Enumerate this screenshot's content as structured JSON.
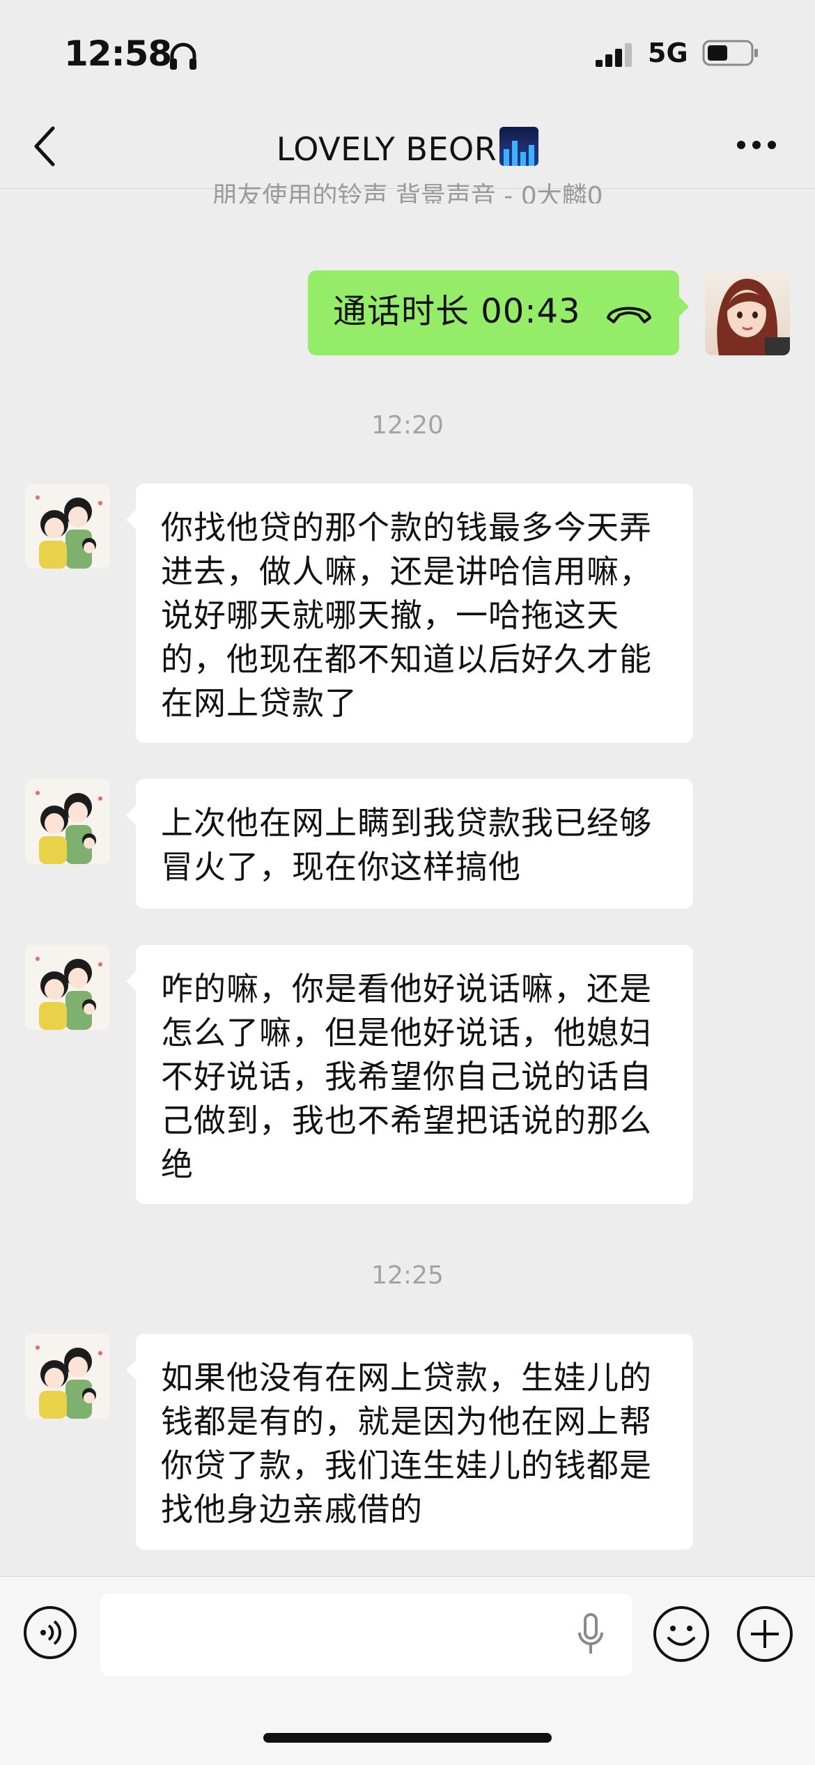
{
  "status_bar": {
    "time": "12:58",
    "network": "5G"
  },
  "nav": {
    "title": "LOVELY BEOR"
  },
  "partial_top_text": "朋友使用的铃声  背景声音 - 0大麟0",
  "call_message": {
    "text": "通话时长 00:43"
  },
  "timestamps": [
    "12:20",
    "12:25"
  ],
  "messages": [
    {
      "text": "你找他贷的那个款的钱最多今天弄进去，做人嘛，还是讲哈信用嘛，说好哪天就哪天撤，一哈拖这天的，他现在都不知道以后好久才能在网上贷款了"
    },
    {
      "text": "上次他在网上瞒到我贷款我已经够冒火了，现在你这样搞他"
    },
    {
      "text": "咋的嘛，你是看他好说话嘛，还是怎么了嘛，但是他好说话，他媳妇不好说话，我希望你自己说的话自己做到，我也不希望把话说的那么绝"
    },
    {
      "text": "如果他没有在网上贷款，生娃儿的钱都是有的，就是因为他在网上帮你贷了款，我们连生娃儿的钱都是找他身边亲戚借的"
    }
  ],
  "input": {
    "placeholder": ""
  },
  "colors": {
    "background": "#ededed",
    "sent_bubble": "#95ec69",
    "received_bubble": "#ffffff"
  },
  "icons": [
    "headphone-icon",
    "signal-icon",
    "battery-icon",
    "back-icon",
    "more-icon",
    "hangup-icon",
    "voice-icon",
    "mic-icon",
    "emoji-icon",
    "add-icon"
  ]
}
